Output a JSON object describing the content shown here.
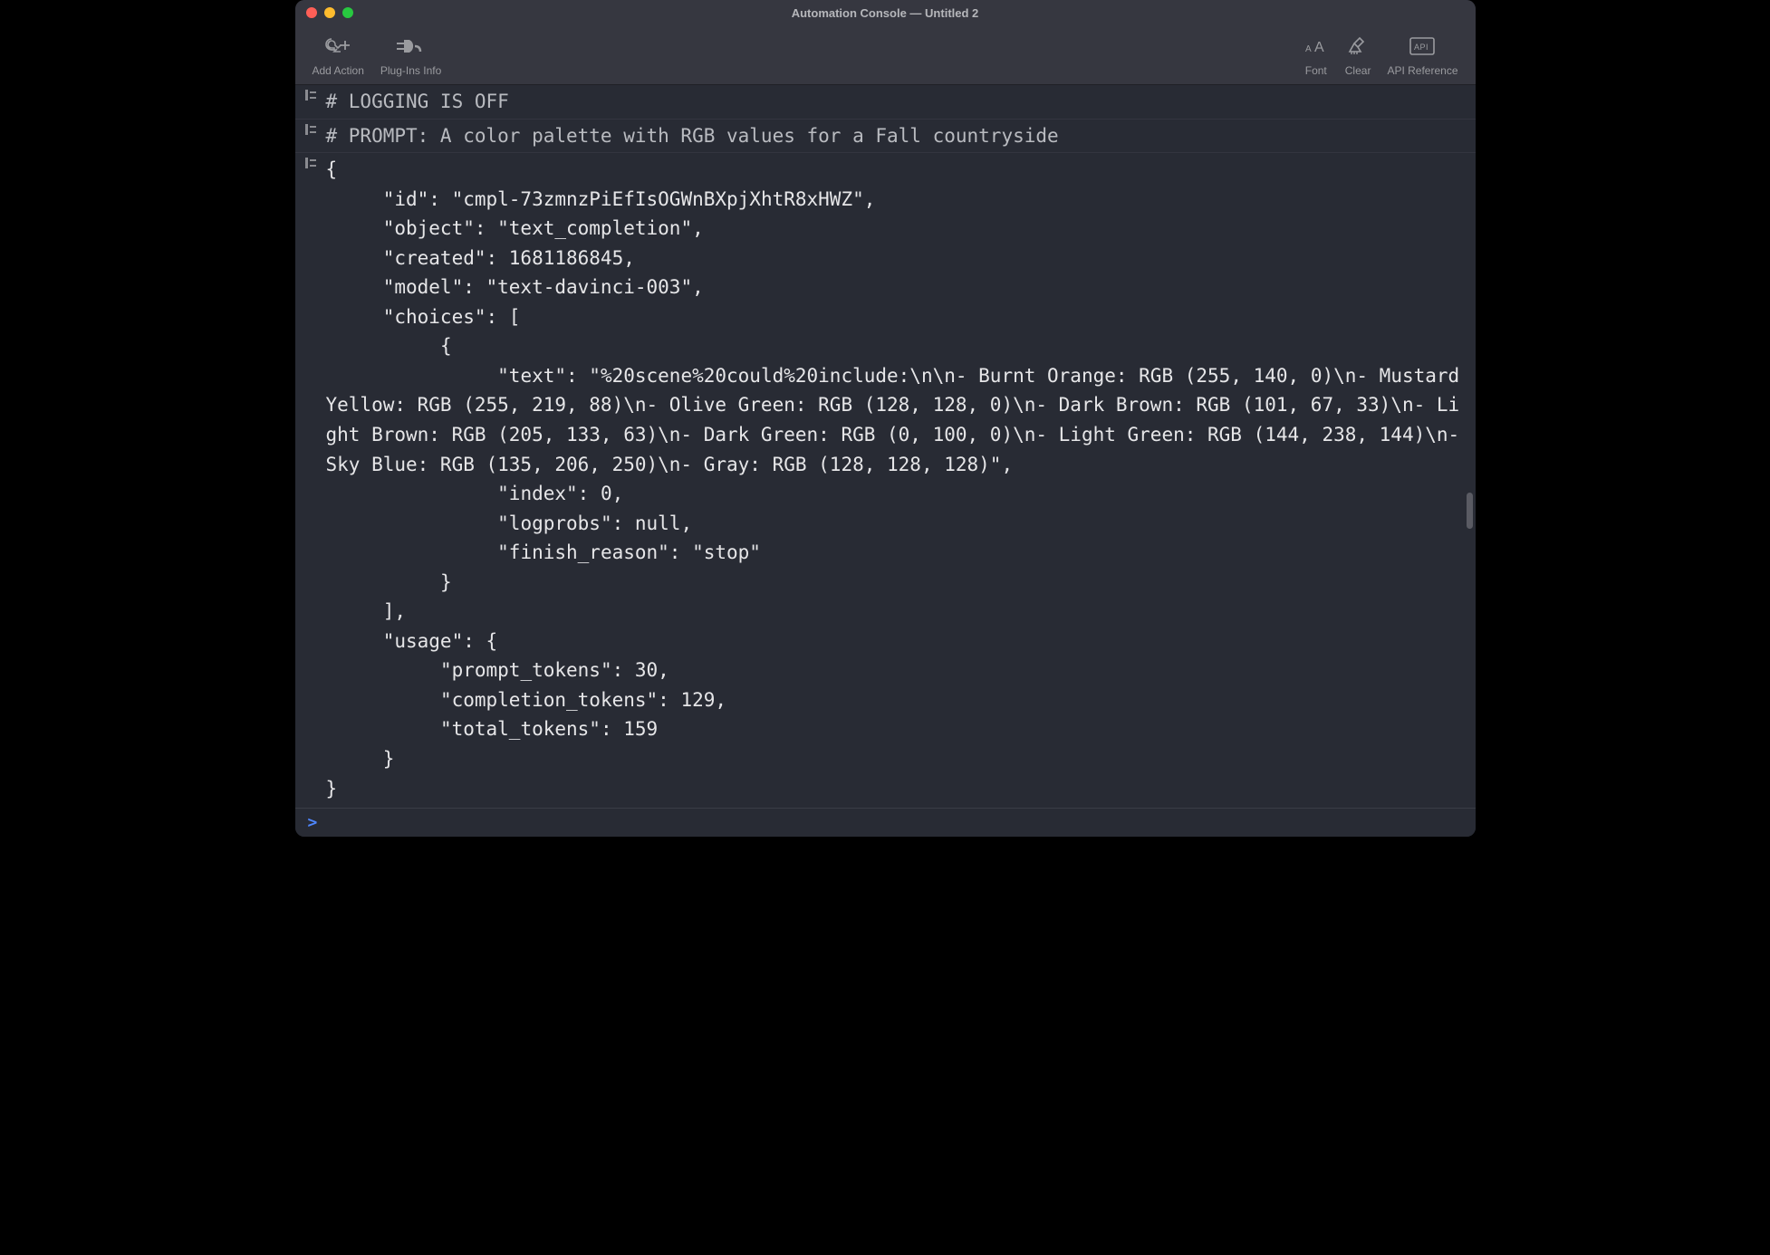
{
  "window": {
    "title": "Automation Console — Untitled 2"
  },
  "toolbar": {
    "add_action": "Add Action",
    "plugins_info": "Plug-Ins Info",
    "font": "Font",
    "clear": "Clear",
    "api_reference": "API Reference"
  },
  "console_lines": {
    "line1": "# LOGGING IS OFF",
    "line2": "# PROMPT: A color palette with RGB values for a Fall countryside",
    "line3": "{\n     \"id\": \"cmpl-73zmnzPiEfIsOGWnBXpjXhtR8xHWZ\",\n     \"object\": \"text_completion\",\n     \"created\": 1681186845,\n     \"model\": \"text-davinci-003\",\n     \"choices\": [\n          {\n               \"text\": \"%20scene%20could%20include:\\n\\n- Burnt Orange: RGB (255, 140, 0)\\n- Mustard Yellow: RGB (255, 219, 88)\\n- Olive Green: RGB (128, 128, 0)\\n- Dark Brown: RGB (101, 67, 33)\\n- Light Brown: RGB (205, 133, 63)\\n- Dark Green: RGB (0, 100, 0)\\n- Light Green: RGB (144, 238, 144)\\n- Sky Blue: RGB (135, 206, 250)\\n- Gray: RGB (128, 128, 128)\",\n               \"index\": 0,\n               \"logprobs\": null,\n               \"finish_reason\": \"stop\"\n          }\n     ],\n     \"usage\": {\n          \"prompt_tokens\": 30,\n          \"completion_tokens\": 129,\n          \"total_tokens\": 159\n     }\n}"
  },
  "prompt": {
    "caret": ">",
    "value": ""
  }
}
